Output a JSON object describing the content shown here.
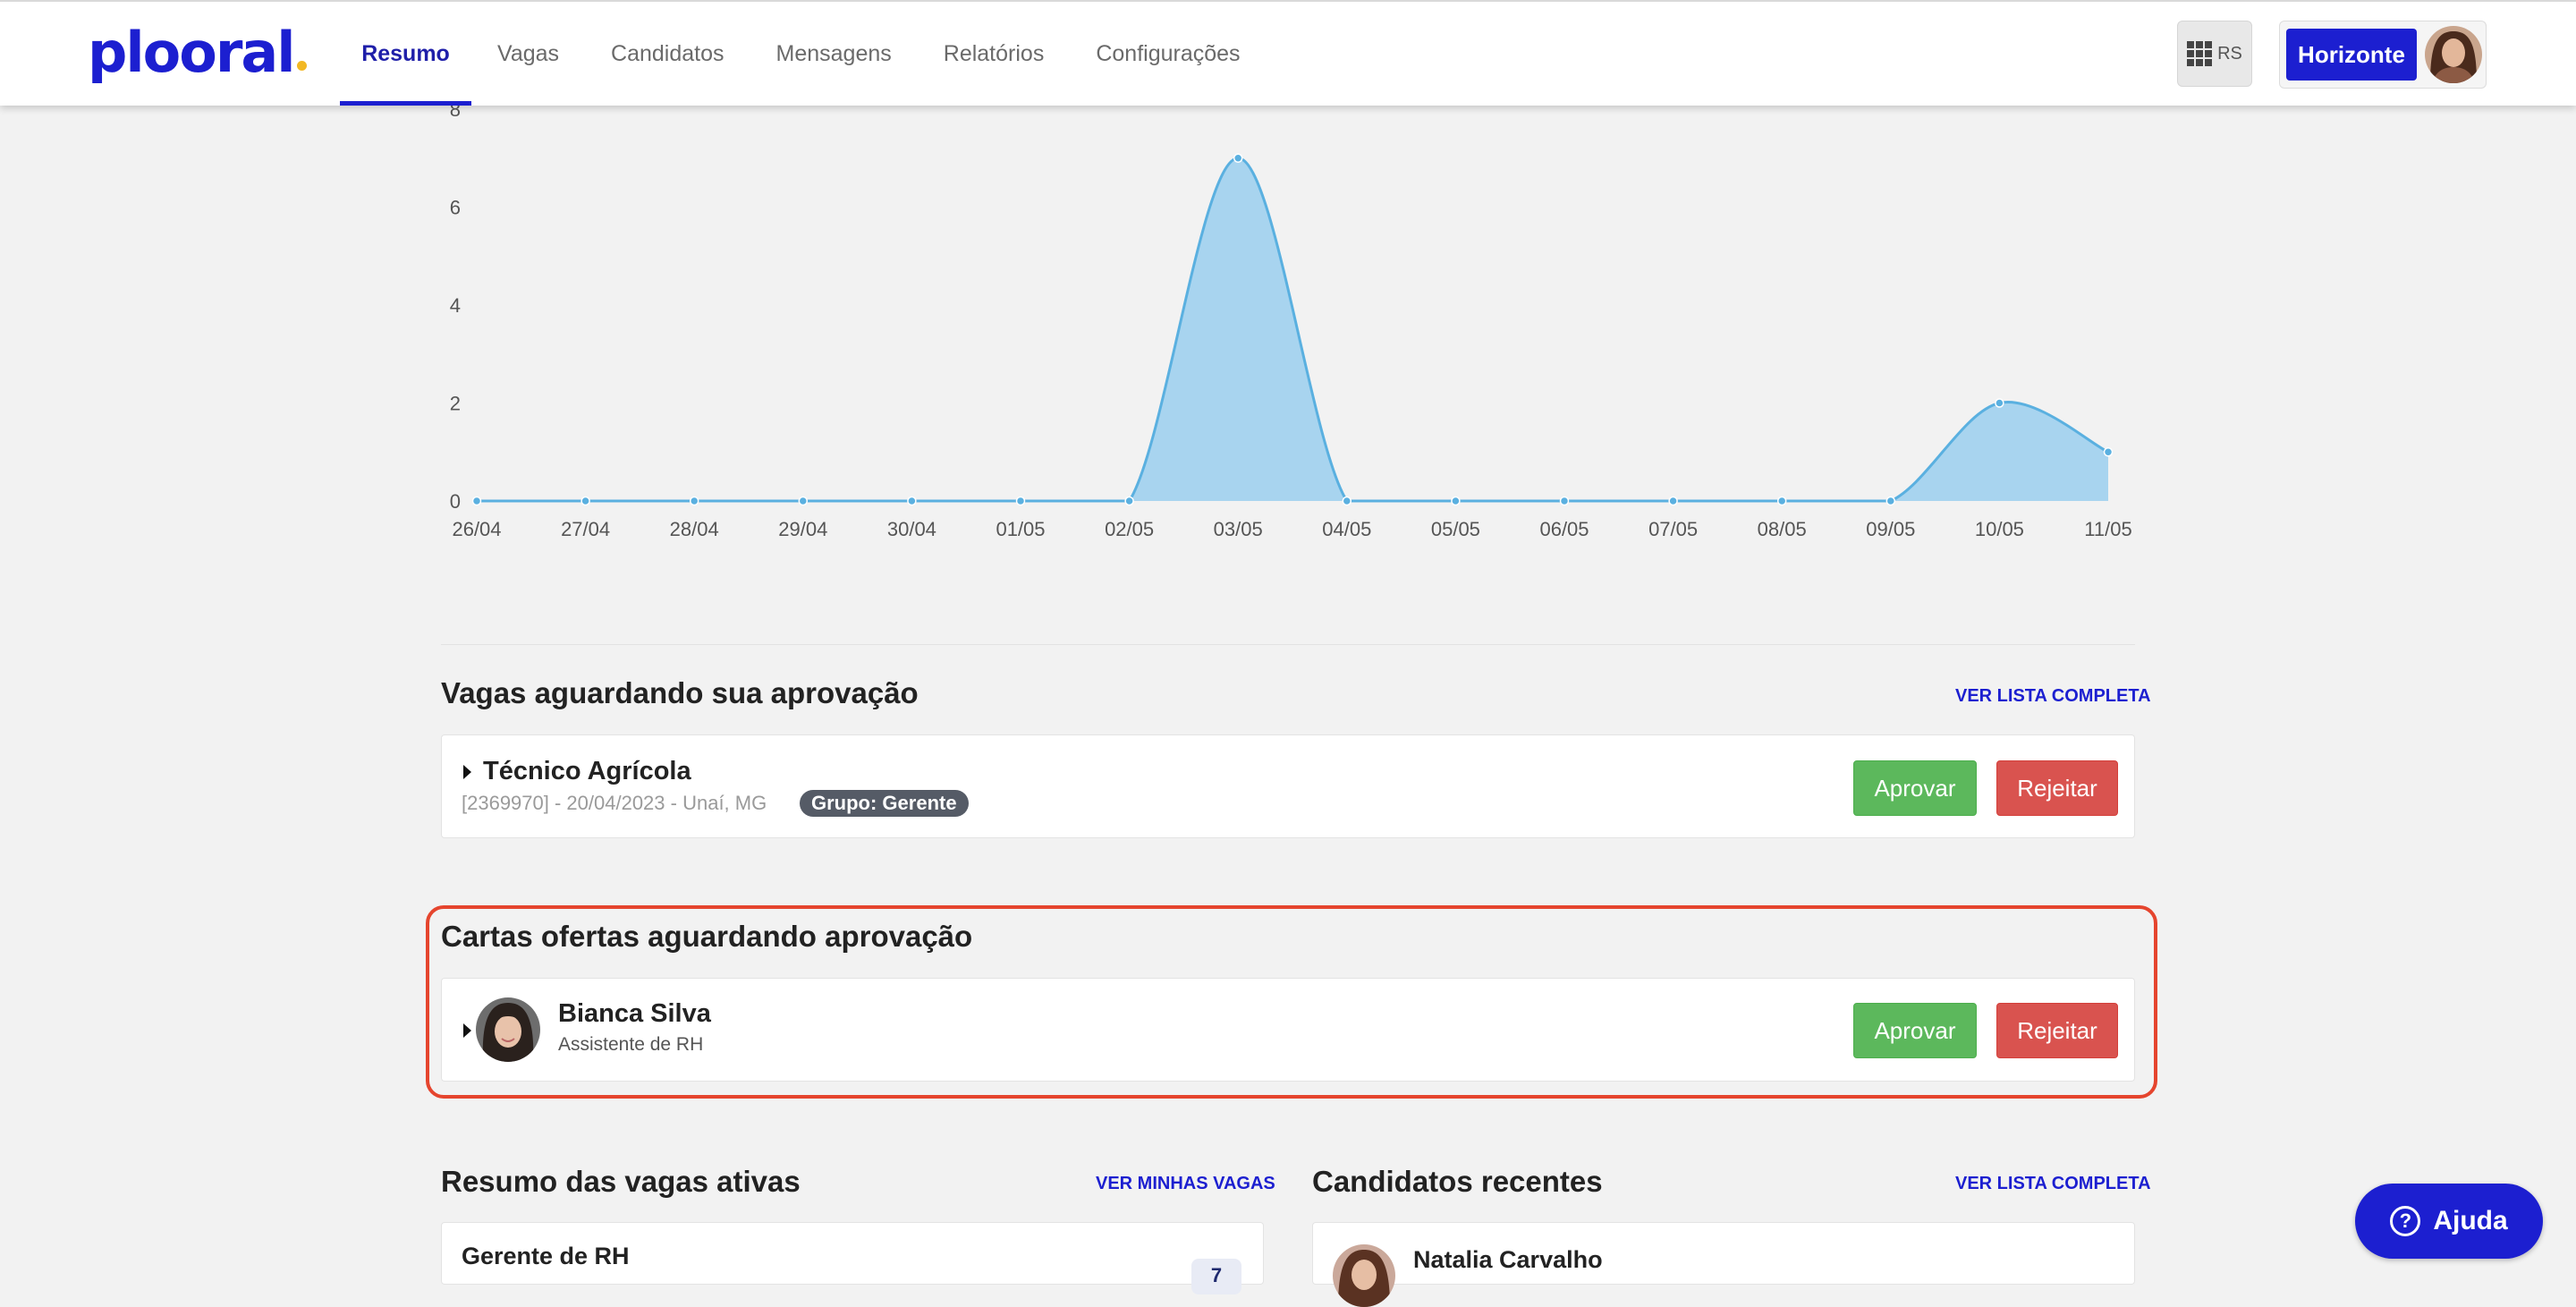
{
  "brand": {
    "logo_text": "plooral",
    "accent_color": "#1c1fd0",
    "dot_color": "#f2b824"
  },
  "nav": {
    "items": [
      {
        "label": "Resumo",
        "active": true
      },
      {
        "label": "Vagas"
      },
      {
        "label": "Candidatos"
      },
      {
        "label": "Mensagens"
      },
      {
        "label": "Relatórios"
      },
      {
        "label": "Configurações"
      }
    ]
  },
  "header": {
    "apps_label": "RS",
    "apps_icon": "grid-icon",
    "account_name": "Horizonte"
  },
  "chart_data": {
    "type": "area",
    "x": [
      "26/04",
      "27/04",
      "28/04",
      "29/04",
      "30/04",
      "01/05",
      "02/05",
      "03/05",
      "04/05",
      "05/05",
      "06/05",
      "07/05",
      "08/05",
      "09/05",
      "10/05",
      "11/05"
    ],
    "series": [
      {
        "values": [
          0,
          0,
          0,
          0,
          0,
          0,
          0,
          7,
          0,
          0,
          0,
          0,
          0,
          0,
          2,
          1
        ]
      }
    ],
    "y_ticks": [
      "0",
      "2",
      "4",
      "6",
      "8"
    ],
    "ylim": [
      0,
      8
    ],
    "fill_color": "#a8d4ef",
    "line_color": "#5ab0e0",
    "grid": false
  },
  "pending_jobs": {
    "title": "Vagas aguardando sua aprovação",
    "link": "VER LISTA COMPLETA",
    "items": [
      {
        "title": "Técnico Agrícola",
        "meta": "[2369970] - 20/04/2023 - Unaí, MG",
        "badge": "Grupo: Gerente",
        "approve": "Aprovar",
        "reject": "Rejeitar"
      }
    ]
  },
  "pending_offers": {
    "title": "Cartas ofertas aguardando aprovação",
    "items": [
      {
        "name": "Bianca Silva",
        "role": "Assistente de RH",
        "approve": "Aprovar",
        "reject": "Rejeitar"
      }
    ]
  },
  "active_jobs": {
    "title": "Resumo das vagas ativas",
    "link": "VER MINHAS VAGAS",
    "items": [
      {
        "title": "Gerente de RH",
        "count": "7"
      }
    ]
  },
  "recent_candidates": {
    "title": "Candidatos recentes",
    "link": "VER LISTA COMPLETA",
    "items": [
      {
        "name": "Natalia Carvalho"
      }
    ]
  },
  "help": {
    "label": "Ajuda"
  }
}
